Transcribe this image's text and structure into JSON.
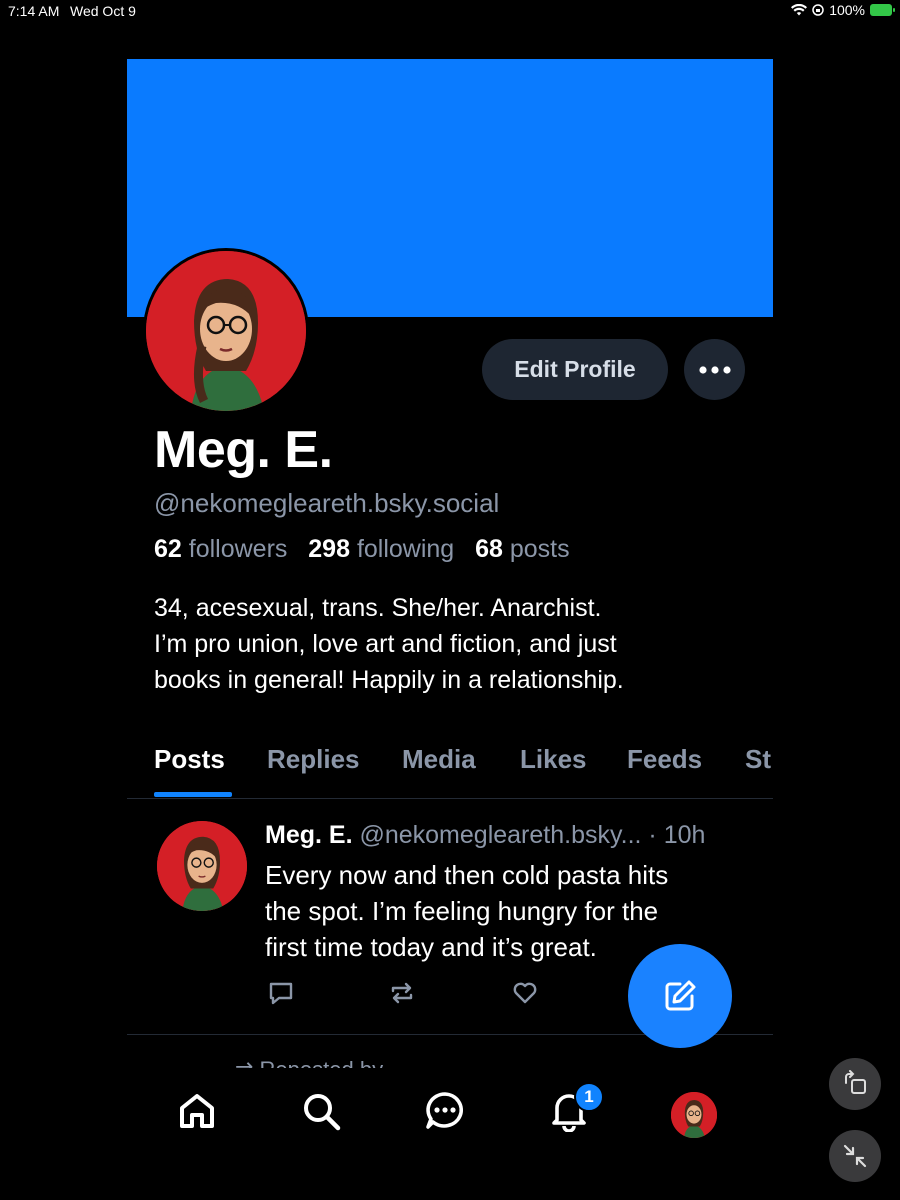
{
  "status_bar": {
    "time": "7:14 AM",
    "date": "Wed Oct 9",
    "battery": "100%"
  },
  "profile": {
    "display_name": "Meg. E.",
    "handle": "@nekomegleareth.bsky.social",
    "edit_label": "Edit Profile",
    "followers_count": "62",
    "followers_label": "followers",
    "following_count": "298",
    "following_label": "following",
    "posts_count": "68",
    "posts_label": "posts",
    "bio_lines": [
      "34, acesexual, trans. She/her. Anarchist.",
      "I’m pro union, love art and fiction, and just",
      "books in general! Happily in a relationship."
    ],
    "banner_color": "#0a7bff"
  },
  "tabs": [
    {
      "label": "Posts",
      "active": true
    },
    {
      "label": "Replies",
      "active": false
    },
    {
      "label": "Media",
      "active": false
    },
    {
      "label": "Likes",
      "active": false
    },
    {
      "label": "Feeds",
      "active": false
    },
    {
      "label": "St",
      "active": false
    }
  ],
  "post": {
    "author_name": "Meg. E.",
    "author_handle": "@nekomegleareth.bsky...",
    "time": "· 10h",
    "text_lines": [
      "Every now and then cold pasta hits",
      "the spot. I’m feeling hungry for the",
      "first time today and it’s great."
    ],
    "actions": [
      "reply-icon",
      "repost-icon",
      "like-icon"
    ]
  },
  "next_post_hint": "⇄ Reposted by",
  "bottom_nav": {
    "items": [
      "home-icon",
      "search-icon",
      "chat-icon",
      "notifications-icon",
      "profile-avatar"
    ],
    "notification_badge": "1"
  },
  "colors": {
    "accent": "#1083fe",
    "muted_text": "#8b96a8",
    "button_bg": "#1e2632"
  }
}
